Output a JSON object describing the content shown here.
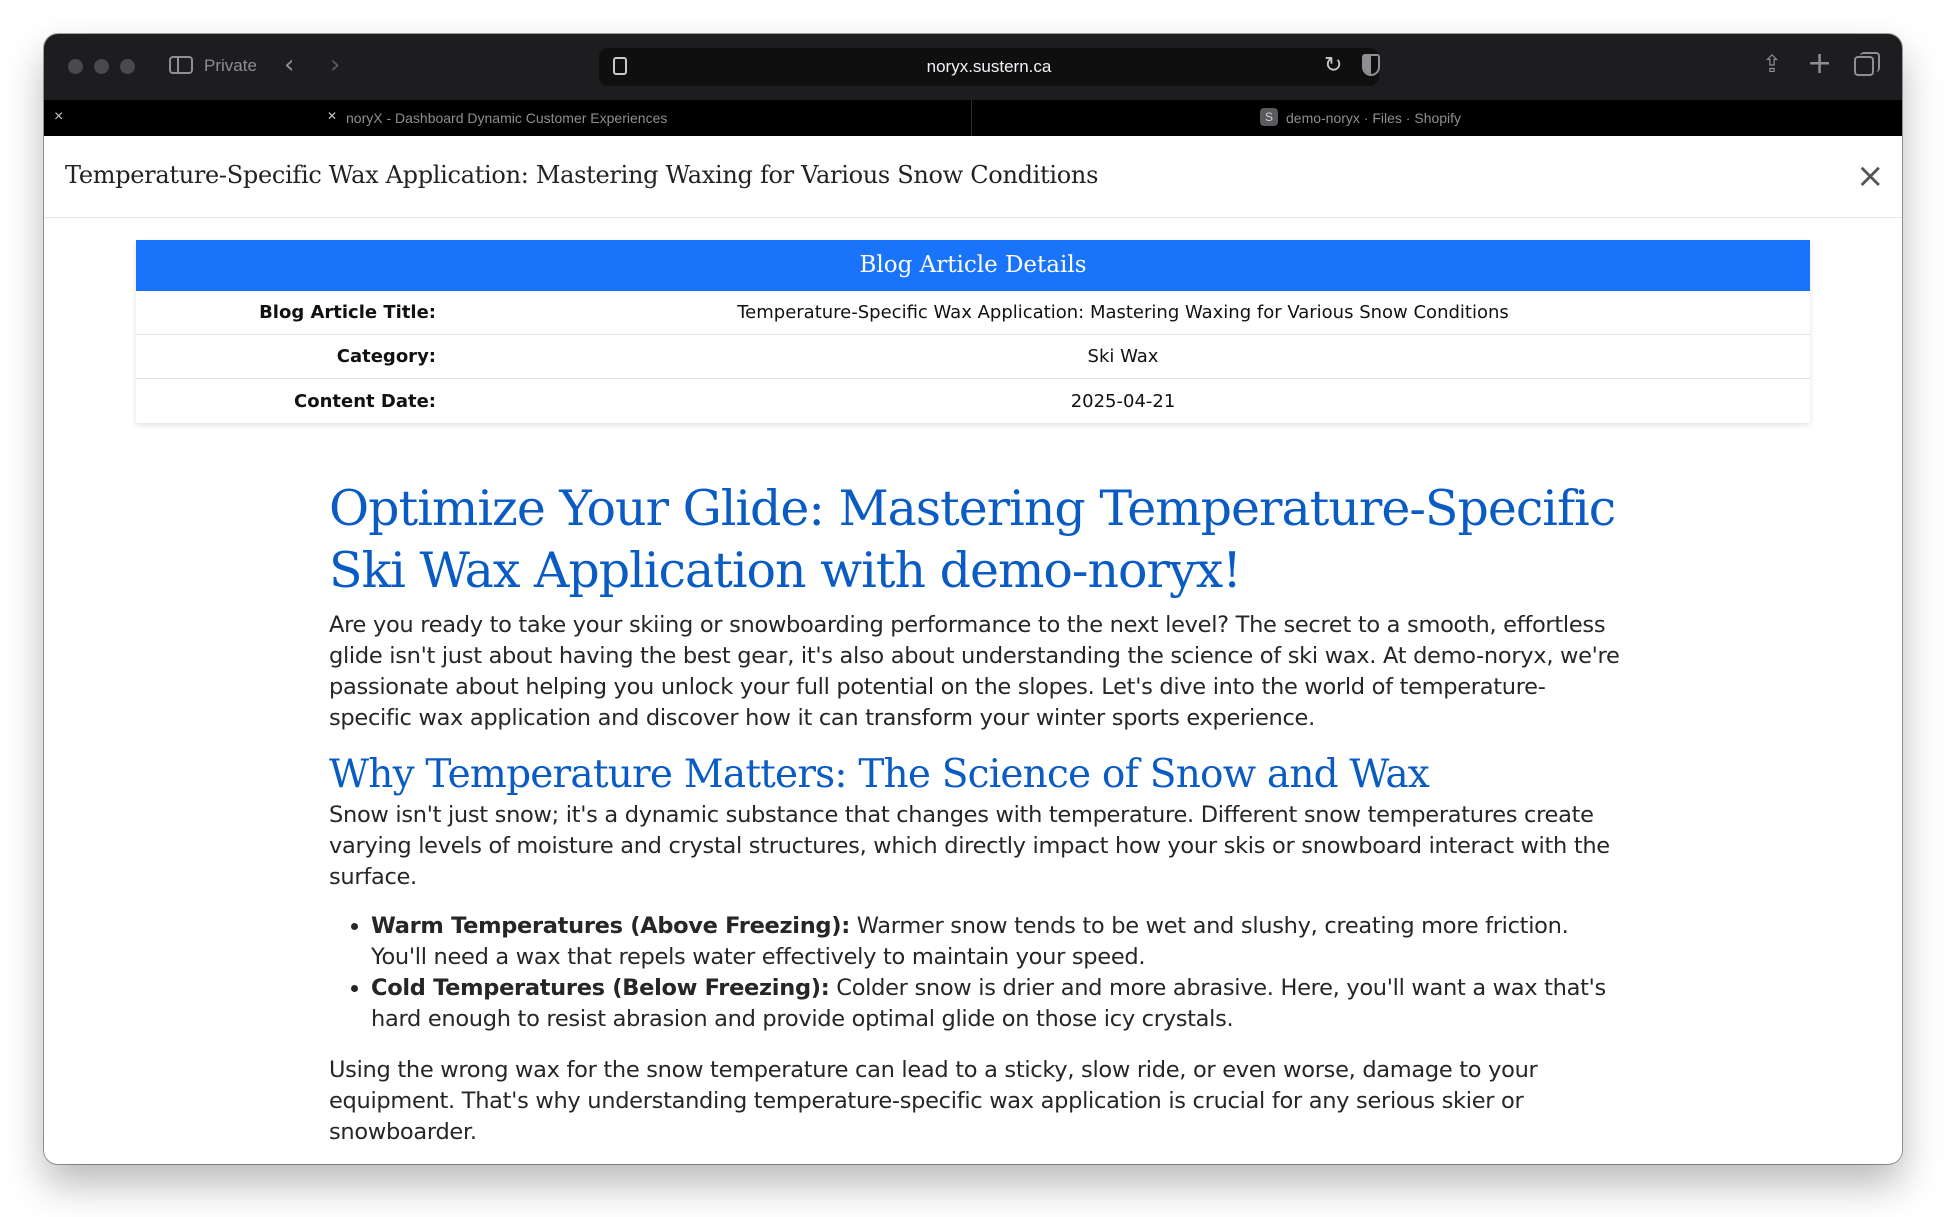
{
  "browser": {
    "private_label": "Private",
    "url": "noryx.sustern.ca",
    "tabs": [
      {
        "title": "noryX - Dashboard Dynamic Customer Experiences",
        "favicon": "noryx-icon"
      },
      {
        "title": "demo-noryx · Files · Shopify",
        "favicon_letter": "S"
      }
    ]
  },
  "modal": {
    "title": "Temperature-Specific Wax Application: Mastering Waxing for Various Snow Conditions",
    "close_label": "×"
  },
  "details": {
    "heading": "Blog Article Details",
    "rows": [
      {
        "label": "Blog Article Title:",
        "value": "Temperature-Specific Wax Application: Mastering Waxing for Various Snow Conditions"
      },
      {
        "label": "Category:",
        "value": "Ski Wax"
      },
      {
        "label": "Content Date:",
        "value": "2025-04-21"
      }
    ]
  },
  "article": {
    "h1": "Optimize Your Glide: Mastering Temperature-Specific Ski Wax Application with demo-noryx!",
    "intro": "Are you ready to take your skiing or snowboarding performance to the next level? The secret to a smooth, effortless glide isn't just about having the best gear, it's also about understanding the science of ski wax. At demo-noryx, we're passionate about helping you unlock your full potential on the slopes. Let's dive into the world of temperature-specific wax application and discover how it can transform your winter sports experience.",
    "h2": "Why Temperature Matters: The Science of Snow and Wax",
    "p2": "Snow isn't just snow; it's a dynamic substance that changes with temperature. Different snow temperatures create varying levels of moisture and crystal structures, which directly impact how your skis or snowboard interact with the surface.",
    "list": [
      {
        "bold": "Warm Temperatures (Above Freezing):",
        "text": " Warmer snow tends to be wet and slushy, creating more friction. You'll need a wax that repels water effectively to maintain your speed."
      },
      {
        "bold": "Cold Temperatures (Below Freezing):",
        "text": " Colder snow is drier and more abrasive. Here, you'll want a wax that's hard enough to resist abrasion and provide optimal glide on those icy crystals."
      }
    ],
    "p3": "Using the wrong wax for the snow temperature can lead to a sticky, slow ride, or even worse, damage to your equipment. That's why understanding temperature-specific wax application is crucial for any serious skier or snowboarder."
  },
  "colors": {
    "accent": "#1a73fb",
    "heading": "#0a5cc4",
    "toolbar": "#1d1d1f"
  }
}
